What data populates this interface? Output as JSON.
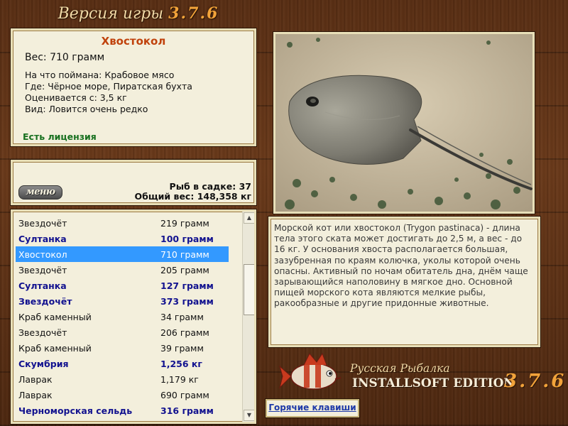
{
  "header": {
    "title": "Версия игры",
    "version": "3.7.6"
  },
  "fish_info": {
    "name": "Хвостокол",
    "weight": "Вес: 710 грамм",
    "lines": [
      "На что поймана: Крабовое мясо",
      "Где: Чёрное море, Пиратская бухта",
      "Оценивается с: 3,5 кг",
      "Вид: Ловится очень редко"
    ],
    "license": "Есть лицензия"
  },
  "menu": {
    "button_label": "меню",
    "fish_count": "Рыб в садке: 37",
    "total_weight": "Общий вес: 148,358 кг"
  },
  "catch_list": [
    {
      "name": "Звездочёт",
      "weight": "219 грамм",
      "style": "normal"
    },
    {
      "name": "Султанка",
      "weight": "100 грамм",
      "style": "bold"
    },
    {
      "name": "Хвостокол",
      "weight": "710 грамм",
      "style": "selected"
    },
    {
      "name": "Звездочёт",
      "weight": "205 грамм",
      "style": "normal"
    },
    {
      "name": "Султанка",
      "weight": "127 грамм",
      "style": "bold"
    },
    {
      "name": "Звездочёт",
      "weight": "373 грамм",
      "style": "bold"
    },
    {
      "name": "Краб каменный",
      "weight": "34 грамм",
      "style": "normal"
    },
    {
      "name": "Звездочёт",
      "weight": "206 грамм",
      "style": "normal"
    },
    {
      "name": "Краб каменный",
      "weight": "39 грамм",
      "style": "normal"
    },
    {
      "name": "Скумбрия",
      "weight": "1,256 кг",
      "style": "bold"
    },
    {
      "name": "Лаврак",
      "weight": "1,179 кг",
      "style": "normal"
    },
    {
      "name": "Лаврак",
      "weight": "690 грамм",
      "style": "normal"
    },
    {
      "name": "Черноморская сельдь",
      "weight": "316 грамм",
      "style": "bold"
    }
  ],
  "description": "Морской кот или хвостокол (Trygon pastinaca) - длина тела этого ската может достигать до 2,5 м, а вес - до 16 кг. У основания хвоста располагается большая, зазубренная по краям колючка, уколы которой очень опасны. Активный по ночам обитатель дна, днём чаще зарывающийся наполовину в мягкое дно. Основной пищей морского кота являются мелкие рыбы, ракообразные и другие придонные животные.",
  "branding": {
    "title": "Русская Рыбалка",
    "edition": "INSTALLSOFT EDITION",
    "version": "3.7.6"
  },
  "hotkeys_label": "Горячие клавиши",
  "icons": {
    "logo": "fish-logo-icon",
    "up": "scroll-up-icon",
    "down": "scroll-down-icon"
  }
}
